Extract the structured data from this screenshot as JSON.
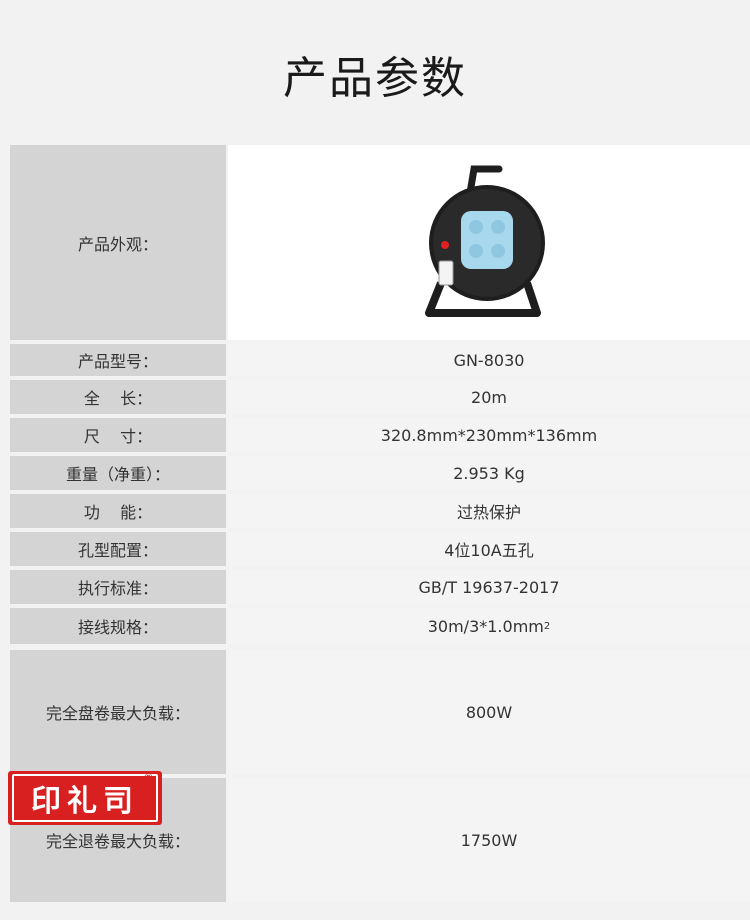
{
  "page_title": "产品参数",
  "rows": [
    {
      "label": "产品外观：",
      "value": ""
    },
    {
      "label": "产品型号：",
      "value": "GN-8030"
    },
    {
      "label": "全    长：",
      "value": "20m"
    },
    {
      "label": "尺    寸：",
      "value": "320.8mm*230mm*136mm"
    },
    {
      "label": "重量（净重）：",
      "value": "2.953 Kg"
    },
    {
      "label": "功    能：",
      "value": "过热保护"
    },
    {
      "label": "孔型配置：",
      "value": "4位10A五孔"
    },
    {
      "label": "执行标准：",
      "value": "GB/T 19637-2017"
    },
    {
      "label": "接线规格：",
      "value": "30m/3*1.0mm",
      "value_sup": "2"
    },
    {
      "label": "完全盘卷最大负载：",
      "value": "800W"
    },
    {
      "label": "完全退卷最大负载：",
      "value": "1750W"
    }
  ],
  "watermark": {
    "text": "印礼司",
    "mark": "®",
    "color": "#d7201f"
  },
  "product_image": {
    "icon": "cable-reel-icon",
    "socket_color": "#a8d8ee",
    "body_color": "#1e1e1e"
  }
}
